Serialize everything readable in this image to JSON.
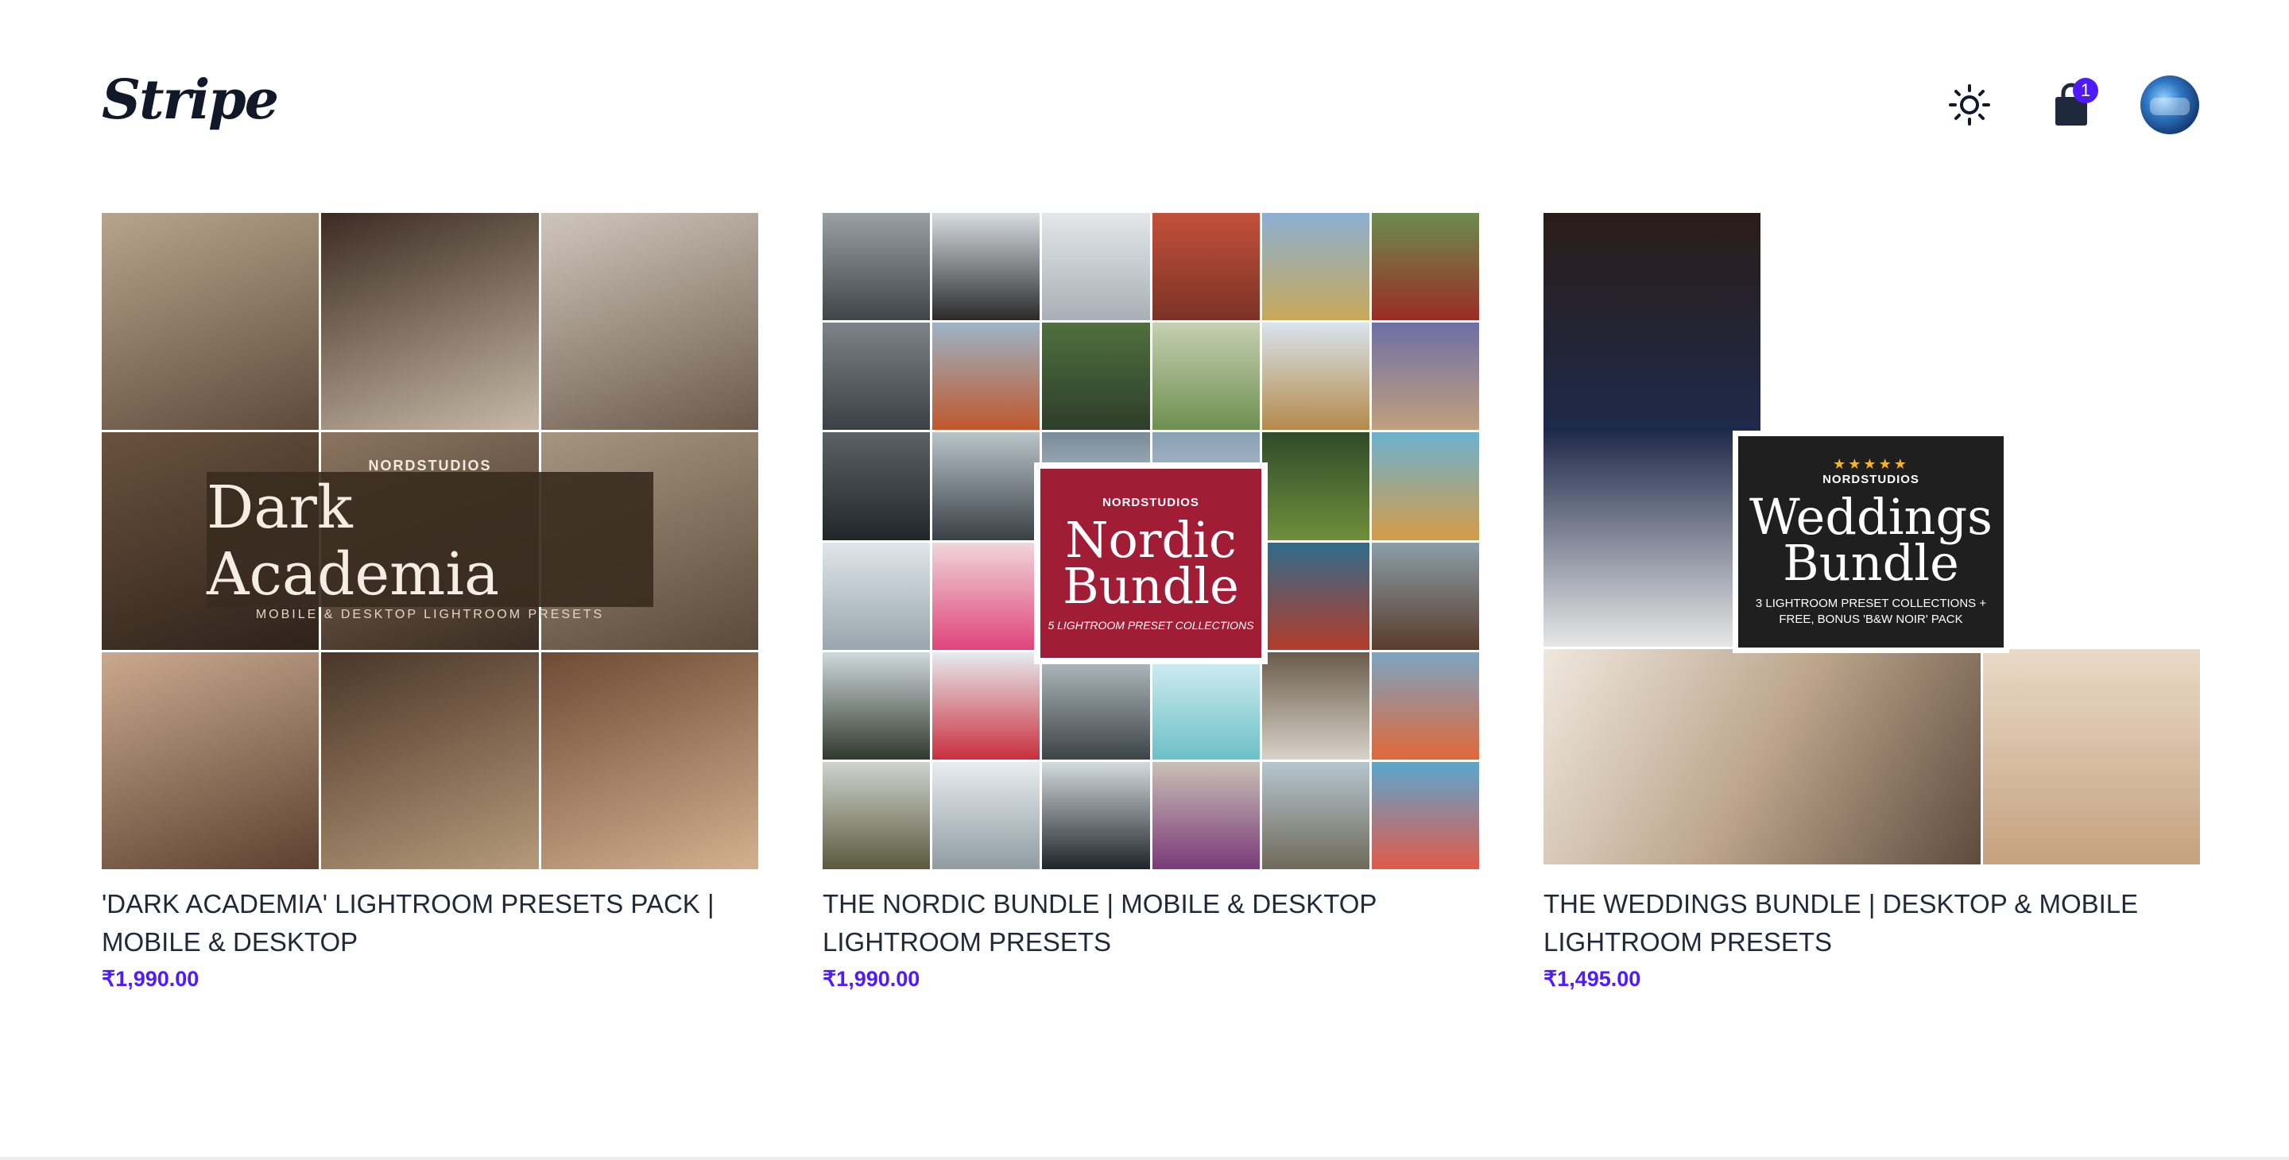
{
  "header": {
    "logo": "Stripe",
    "theme_icon": "sun-icon",
    "cart_icon": "shopping-bag-icon",
    "cart_count": "1",
    "avatar_icon": "user-avatar"
  },
  "products": [
    {
      "title": "'DARK ACADEMIA' LIGHTROOM PRESETS PACK | MOBILE & DESKTOP",
      "price": "₹1,990.00",
      "image": {
        "brand": "NORDSTUDIOS",
        "heading": "Dark Academia",
        "subheading": "MOBILE & DESKTOP LIGHTROOM PRESETS"
      }
    },
    {
      "title": "THE NORDIC BUNDLE | MOBILE & DESKTOP LIGHTROOM PRESETS",
      "price": "₹1,990.00",
      "image": {
        "brand": "NORDSTUDIOS",
        "heading": "Nordic Bundle",
        "subheading": "5 LIGHTROOM PRESET COLLECTIONS"
      }
    },
    {
      "title": "THE WEDDINGS BUNDLE | DESKTOP & MOBILE LIGHTROOM PRESETS",
      "price": "₹1,495.00",
      "image": {
        "rating": "★★★★★",
        "brand": "NORDSTUDIOS",
        "heading": "Weddings Bundle",
        "subheading": "3 LIGHTROOM PRESET COLLECTIONS + FREE, BONUS 'B&W NOIR' PACK"
      }
    }
  ],
  "colors": {
    "accent": "#4f1aff",
    "text": "#1f2937"
  }
}
